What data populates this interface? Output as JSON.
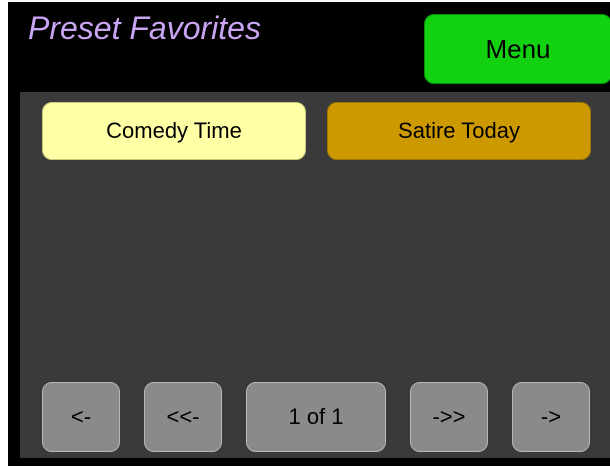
{
  "header": {
    "title": "Preset Favorites",
    "menu_label": "Menu"
  },
  "favorites": [
    {
      "label": "Comedy Time",
      "color": "#ffffa6"
    },
    {
      "label": "Satire Today",
      "color": "#cc9900"
    }
  ],
  "pagination": {
    "prev_label": "<-",
    "first_label": "<<-",
    "page_label": "1 of 1",
    "last_label": "->>",
    "next_label": "->"
  },
  "colors": {
    "title": "#c9a4f2",
    "menu_button": "#11d111",
    "panel": "#3a3a3a",
    "nav_button": "#8a8a8a",
    "background": "#000000"
  }
}
